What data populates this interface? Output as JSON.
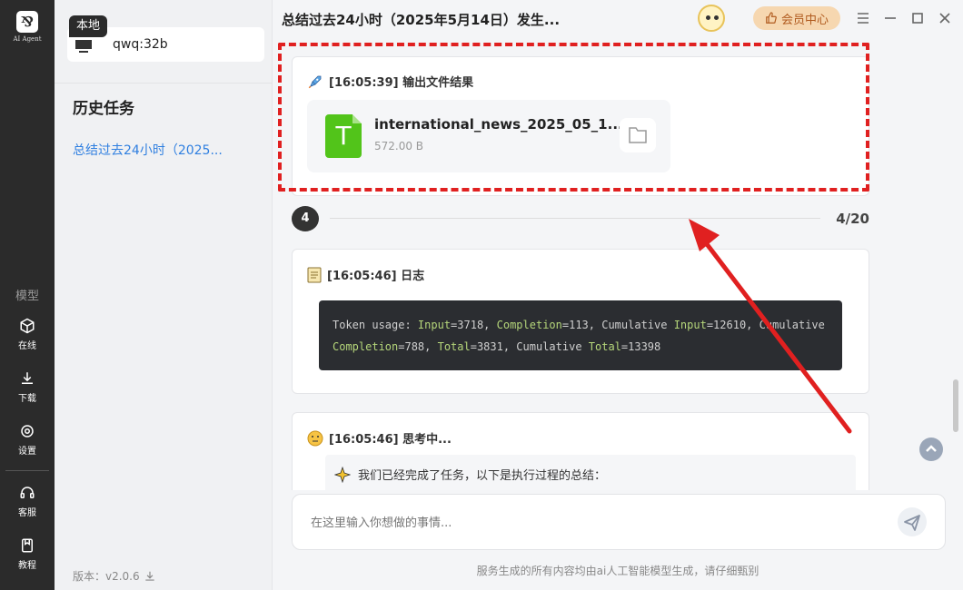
{
  "rail": {
    "logo_text": "AI Agent",
    "section_label": "模型",
    "items": [
      {
        "label": "在线",
        "icon": "cube-icon"
      },
      {
        "label": "下载",
        "icon": "download-icon"
      },
      {
        "label": "设置",
        "icon": "gear-icon"
      },
      {
        "label": "客服",
        "icon": "headset-icon"
      },
      {
        "label": "教程",
        "icon": "book-icon"
      }
    ]
  },
  "sidebar": {
    "model_tag": "本地",
    "model_name": "qwq:32b",
    "history_title": "历史任务",
    "history_items": [
      "总结过去24小时（2025..."
    ],
    "version": "版本：v2.0.6"
  },
  "header": {
    "title": "总结过去24小时（2025年5月14日）发生...",
    "member_label": "会员中心"
  },
  "messages": {
    "file_result": {
      "header": "[16:05:39] 输出文件结果",
      "file_letter": "T",
      "file_name": "international_news_2025_05_1...",
      "file_size": "572.00 B"
    },
    "step": {
      "number": "4",
      "count": "4/20"
    },
    "log": {
      "header": "[16:05:46] 日志",
      "text_parts": [
        "Token usage: ",
        "Input",
        "=3718, ",
        "Completion",
        "=113, Cumulative ",
        "Input",
        "=12610, Cumulative ",
        "Completion",
        "=788, ",
        "Total",
        "=3831, Cumulative ",
        "Total",
        "=13398"
      ]
    },
    "thinking": {
      "header": "[16:05:46] 思考中...",
      "line": "我们已经完成了任务，以下是执行过程的总结："
    }
  },
  "input": {
    "placeholder": "在这里输入你想做的事情..."
  },
  "footer": "服务生成的所有内容均由ai人工智能模型生成，请仔细甄别",
  "colors": {
    "accent": "#2f7fe0",
    "highlight": "#e02020",
    "file_green": "#52c41a",
    "member_bg": "#f6d7b0"
  }
}
